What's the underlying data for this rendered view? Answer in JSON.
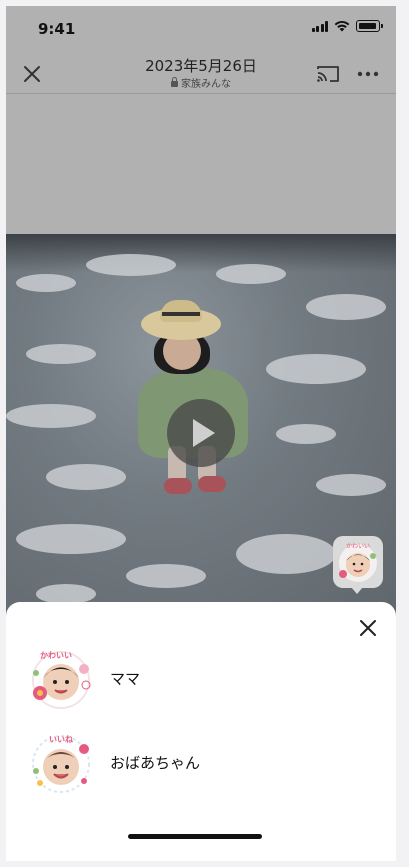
{
  "status_bar": {
    "time": "9:41"
  },
  "header": {
    "title": "2023年5月26日",
    "subtitle": "家族みんな"
  },
  "sticker_bubble": {
    "sticker_text": "かわいい"
  },
  "sheet": {
    "items": [
      {
        "label": "ママ",
        "sticker_text": "かわいい"
      },
      {
        "label": "おばあちゃん",
        "sticker_text": "いいね"
      }
    ]
  },
  "colors": {
    "dim_overlay": "#b1b1b1",
    "sheet_bg": "#ffffff",
    "accent_pink": "#e55b7f"
  }
}
